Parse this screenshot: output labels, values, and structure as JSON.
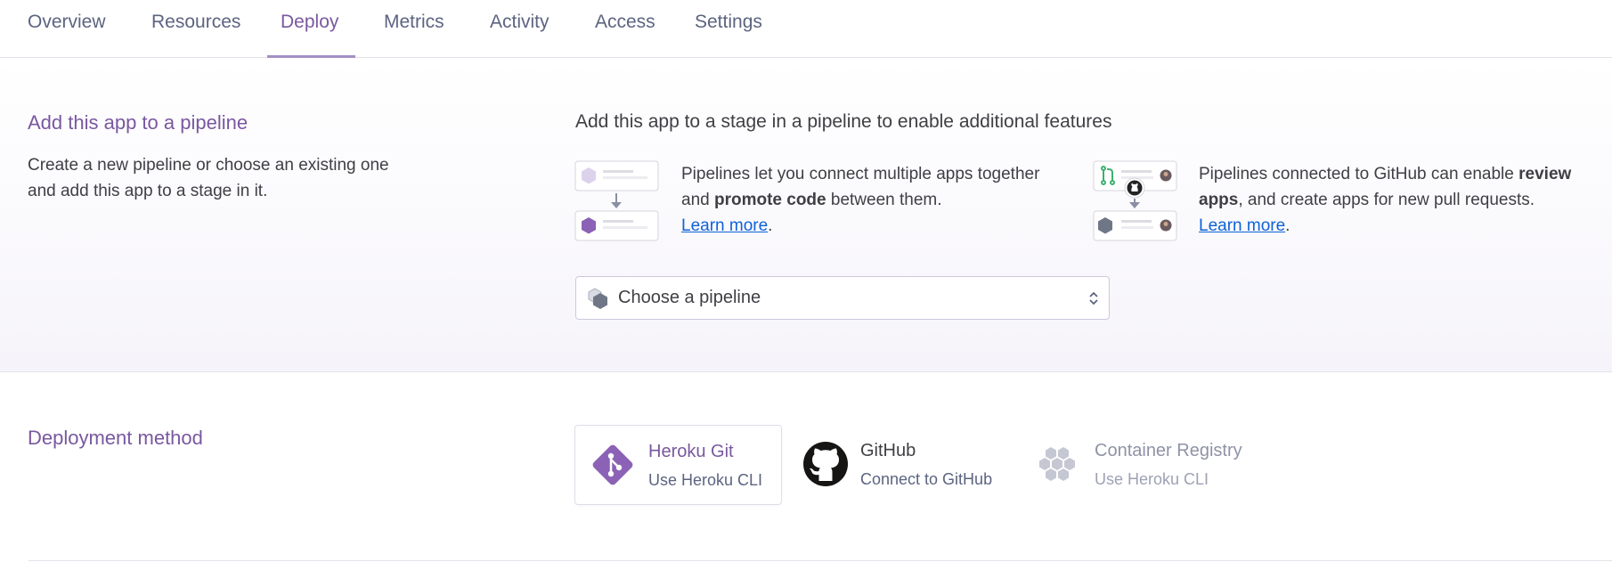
{
  "tabs": [
    {
      "label": "Overview"
    },
    {
      "label": "Resources"
    },
    {
      "label": "Deploy"
    },
    {
      "label": "Metrics"
    },
    {
      "label": "Activity"
    },
    {
      "label": "Access"
    },
    {
      "label": "Settings"
    }
  ],
  "active_tab": "Deploy",
  "pipeline": {
    "title": "Add this app to a pipeline",
    "description": "Create a new pipeline or choose an existing one and add this app to a stage in it.",
    "headline": "Add this app to a stage in a pipeline to enable additional features",
    "feature1": {
      "text_a": "Pipelines let you connect multiple apps together and ",
      "bold": "promote code",
      "text_b": " between them.",
      "link": "Learn more",
      "after": "."
    },
    "feature2": {
      "text_a": "Pipelines connected to GitHub can enable ",
      "bold": "review apps",
      "text_b": ", and create apps for new pull requests.",
      "link": "Learn more",
      "after": "."
    },
    "select_placeholder": "Choose a pipeline"
  },
  "deployment": {
    "title": "Deployment method",
    "options": [
      {
        "title": "Heroku Git",
        "subtitle": "Use Heroku CLI",
        "icon": "heroku-git-icon",
        "selected": true
      },
      {
        "title": "GitHub",
        "subtitle": "Connect to GitHub",
        "icon": "github-icon",
        "selected": false
      },
      {
        "title": "Container Registry",
        "subtitle": "Use Heroku CLI",
        "icon": "container-registry-icon",
        "selected": false
      }
    ]
  },
  "colors": {
    "accent": "#79589f",
    "link": "#0f62d6",
    "muted": "#8e93a6"
  }
}
